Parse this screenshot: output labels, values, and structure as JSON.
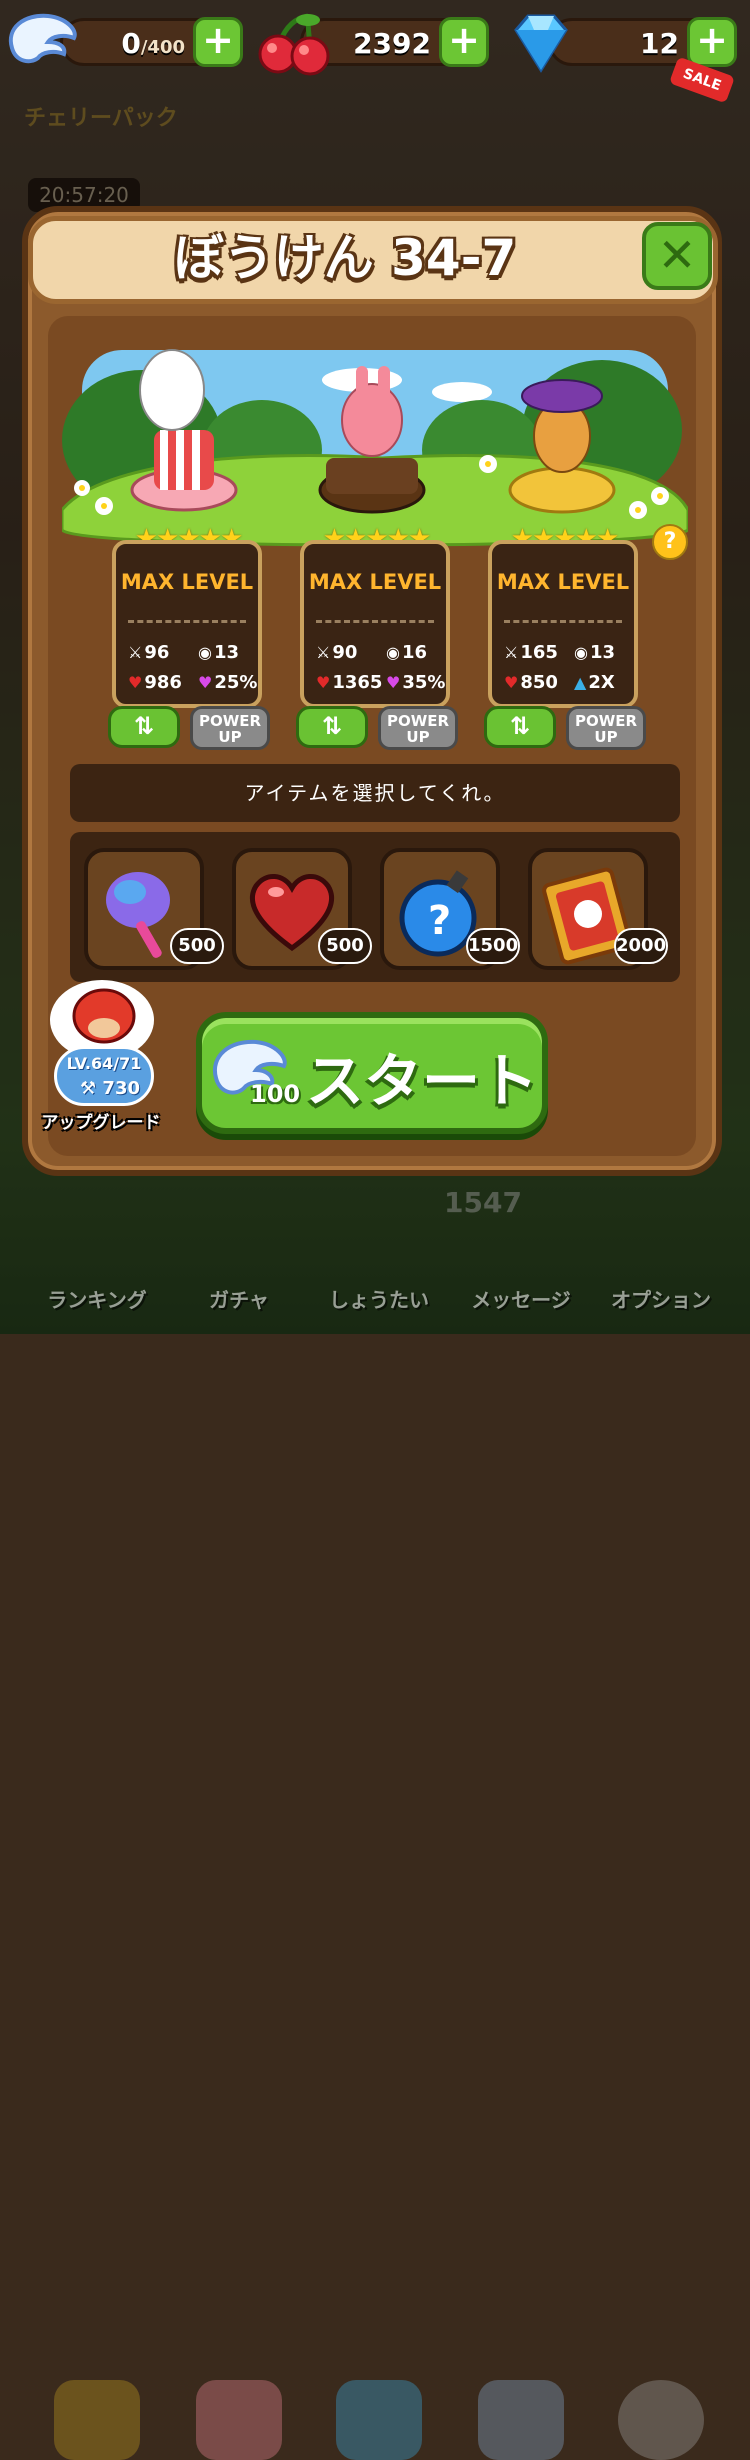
{
  "resources": {
    "hearts": {
      "value": "0",
      "max": "/400"
    },
    "cherries": {
      "value": "2392"
    },
    "gems": {
      "value": "12",
      "badge": "SALE"
    }
  },
  "background": {
    "event_label": "チェリーパック",
    "timer": "20:57:20",
    "score": "1547"
  },
  "stage": {
    "title": "ぼうけん 34-7"
  },
  "characters": [
    {
      "stars": 5,
      "level": "MAX LEVEL",
      "attack": "96",
      "coins": "13",
      "hp": "986",
      "skill": "25%"
    },
    {
      "stars": 5,
      "level": "MAX LEVEL",
      "attack": "90",
      "coins": "16",
      "hp": "1365",
      "skill": "35%"
    },
    {
      "stars": 5,
      "level": "MAX LEVEL",
      "attack": "165",
      "coins": "13",
      "hp": "850",
      "skill": "2X"
    }
  ],
  "buttons": {
    "power_up": "POWER UP",
    "help": "?"
  },
  "item_prompt": "アイテムを選択してくれ。",
  "items": [
    {
      "icon": "cotton-candy-icon",
      "price": "500"
    },
    {
      "icon": "heart-potion-icon",
      "price": "500"
    },
    {
      "icon": "mystery-bomb-icon",
      "price": "1500"
    },
    {
      "icon": "spell-book-icon",
      "price": "2000"
    }
  ],
  "start": {
    "label": "スタート",
    "cost": "100"
  },
  "upgrade": {
    "level": "LV.64/71",
    "cost": "730",
    "label": "アップグレード"
  },
  "nav": [
    {
      "label": "ランキング",
      "icon": "trophy-icon"
    },
    {
      "label": "ガチャ",
      "icon": "gacha-icon"
    },
    {
      "label": "しょうたい",
      "icon": "invite-icon"
    },
    {
      "label": "メッセージ",
      "icon": "mail-icon"
    },
    {
      "label": "オプション",
      "icon": "gear-icon"
    }
  ]
}
